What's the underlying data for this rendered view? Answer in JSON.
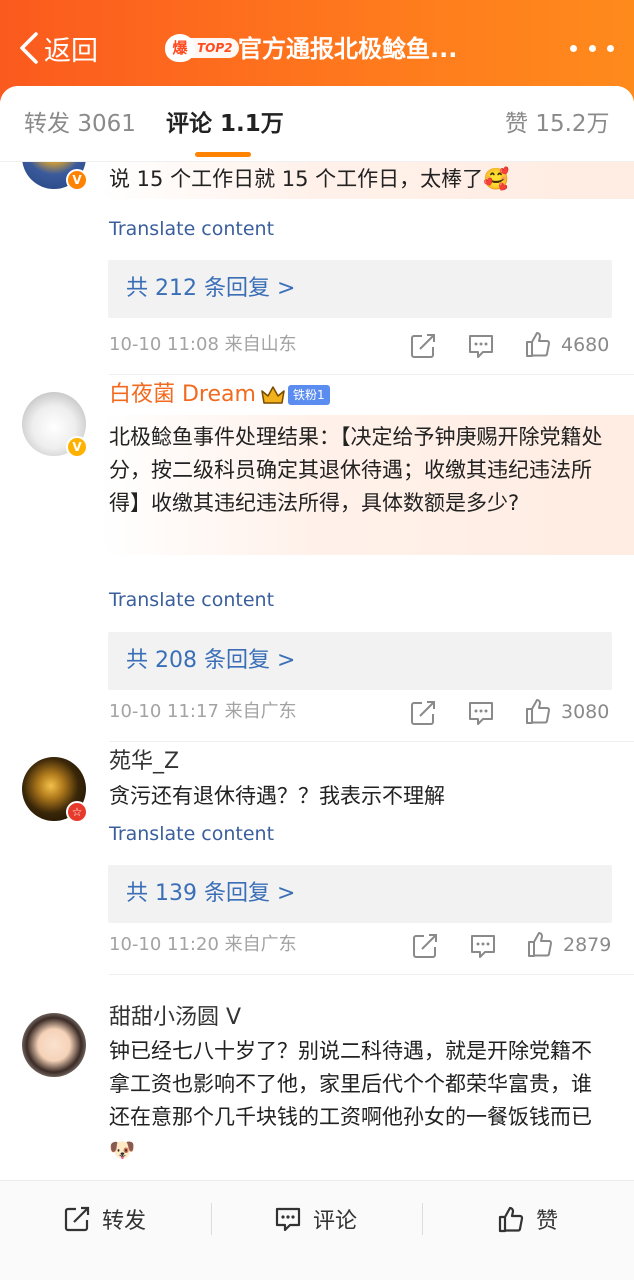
{
  "header": {
    "back_label": "返回",
    "hot_badge": "爆",
    "rank_label": "TOP2",
    "title": "官方通报北极鲶鱼..."
  },
  "tabs": {
    "repost_label": "转发",
    "repost_count": "3061",
    "comment_label": "评论",
    "comment_count": "1.1万",
    "like_label": "赞",
    "like_count": "15.2万"
  },
  "comments": [
    {
      "username": "",
      "text": "说 15 个工作日就 15 个工作日，太棒了🥰",
      "translate": "Translate content",
      "replies": "共 212 条回复 >",
      "time": "10-10 11:08",
      "location": "来自山东",
      "likes": "4680",
      "badge": "V"
    },
    {
      "username": "白夜菌 Dream",
      "fan_badge": "铁粉1",
      "text": "北极鲶鱼事件处理结果：【决定给予钟庚赐开除党籍处分，按二级科员确定其退休待遇；收缴其违纪违法所得】收缴其违纪违法所得，具体数额是多少?",
      "translate": "Translate content",
      "replies": "共 208 条回复 >",
      "time": "10-10 11:17",
      "location": "来自广东",
      "likes": "3080",
      "badge": "V"
    },
    {
      "username": "苑华_Z",
      "text": "贪污还有退休待遇？？我表示不理解",
      "translate": "Translate content",
      "replies": "共 139 条回复 >",
      "time": "10-10 11:20",
      "location": "来自广东",
      "likes": "2879",
      "badge": "☆"
    },
    {
      "username": "甜甜小汤圆 V",
      "text": "钟已经七八十岁了？别说二科待遇，就是开除党籍不拿工资也影响不了他，家里后代个个都荣华富贵，谁还在意那个几千块钱的工资啊他孙女的一餐饭钱而已🐶"
    }
  ],
  "bottom_bar": {
    "repost_label": "转发",
    "comment_label": "评论",
    "like_label": "赞"
  },
  "colors": {
    "header_gradient_start": "#fb5a1e",
    "header_gradient_end": "#ff8a1c",
    "accent_orange": "#ff8200",
    "link_blue": "#3a6fb8",
    "username_orange": "#f26a1f"
  },
  "icons": [
    "back-arrow-icon",
    "more-dots-icon",
    "repost-icon",
    "comment-icon",
    "like-icon",
    "verified-badge-icon",
    "crown-icon"
  ]
}
